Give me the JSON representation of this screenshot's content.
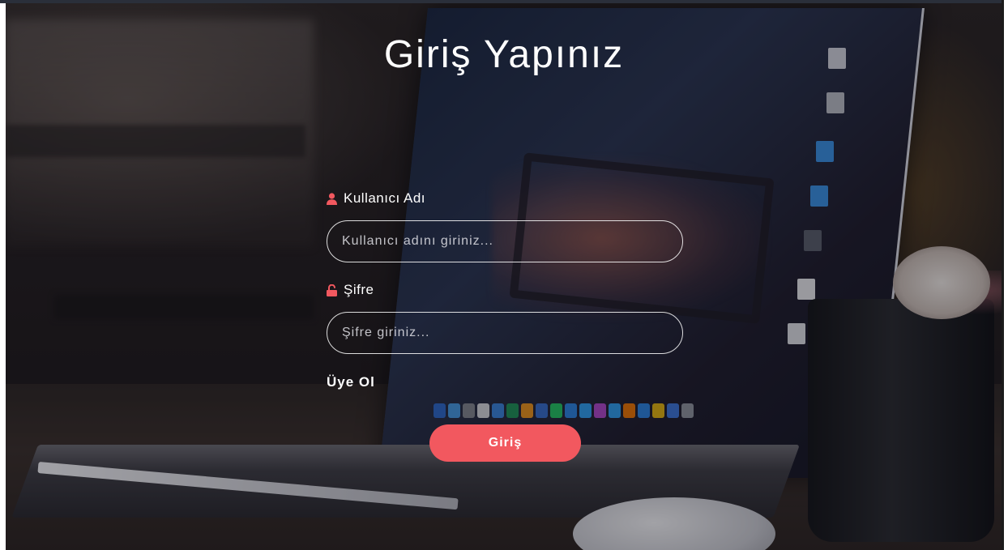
{
  "page": {
    "title": "Giriş Yapınız"
  },
  "form": {
    "username": {
      "label": "Kullanıcı Adı",
      "placeholder": "Kullanıcı adını giriniz...",
      "value": "",
      "icon": "user-icon"
    },
    "password": {
      "label": "Şifre",
      "placeholder": "Şifre giriniz...",
      "value": "",
      "icon": "unlock-icon"
    },
    "signup_link": "Üye Ol",
    "submit_label": "Giriş"
  },
  "colors": {
    "accent": "#f2585f",
    "text": "#ffffff",
    "background_tint": "#1a1617"
  }
}
